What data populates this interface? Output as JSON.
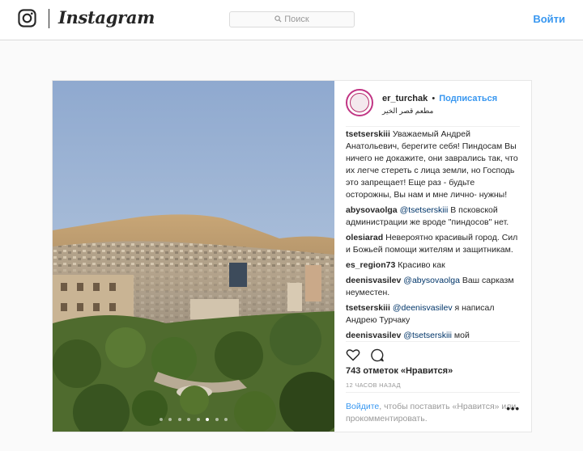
{
  "header": {
    "brand": "Instagram",
    "search_placeholder": "Поиск",
    "login_label": "Войти"
  },
  "post": {
    "author": "er_turchak",
    "bullet": "•",
    "follow_label": "Подписаться",
    "location": "مطعم قصر الخير",
    "comments": [
      {
        "user": "tsetserskiii",
        "parts": [
          {
            "text": "Уважаемый Андрей Анатольевич, берегите себя! Пиндосам Вы ничего не докажите, они заврались так, что их легче стереть с лица земли, но Господь это запрещает! Еще раз - будьте осторожны, Вы нам и мне лично- нужны!"
          }
        ]
      },
      {
        "user": "abysovaolga",
        "parts": [
          {
            "mention": "@tsetserskiii"
          },
          {
            "text": " В псковской администрации же вроде \"пиндосов\" нет."
          }
        ]
      },
      {
        "user": "olesiarad",
        "parts": [
          {
            "text": "Невероятно красивый город. Сил и Божьей помощи жителям и защитникам."
          }
        ]
      },
      {
        "user": "es_region73",
        "parts": [
          {
            "text": "Красиво как"
          }
        ]
      },
      {
        "user": "deenisvasilev",
        "parts": [
          {
            "mention": "@abysovaolga"
          },
          {
            "text": " Ваш сарказм неуместен."
          }
        ]
      },
      {
        "user": "tsetserskiii",
        "parts": [
          {
            "mention": "@deenisvasilev"
          },
          {
            "text": " я написал Андрею Турчаку"
          }
        ]
      },
      {
        "user": "deenisvasilev",
        "parts": [
          {
            "mention": "@tsetserskiii"
          },
          {
            "text": " мой"
          }
        ]
      }
    ],
    "likes": "743 отметок «Нравится»",
    "time": "12 ЧАСОВ НАЗАД",
    "login_link": "Войдите",
    "login_prompt": ", чтобы поставить «Нравится» или прокомментировать.",
    "more_label": "•••",
    "carousel": {
      "total": 8,
      "active": 5
    },
    "icons": {
      "like": "heart-icon",
      "comment": "comment-icon",
      "search": "search-icon",
      "logo": "instagram-camera-icon"
    }
  },
  "colors": {
    "accent": "#3897f0",
    "text": "#262626",
    "muted": "#999999",
    "border": "#dbdbdb"
  }
}
